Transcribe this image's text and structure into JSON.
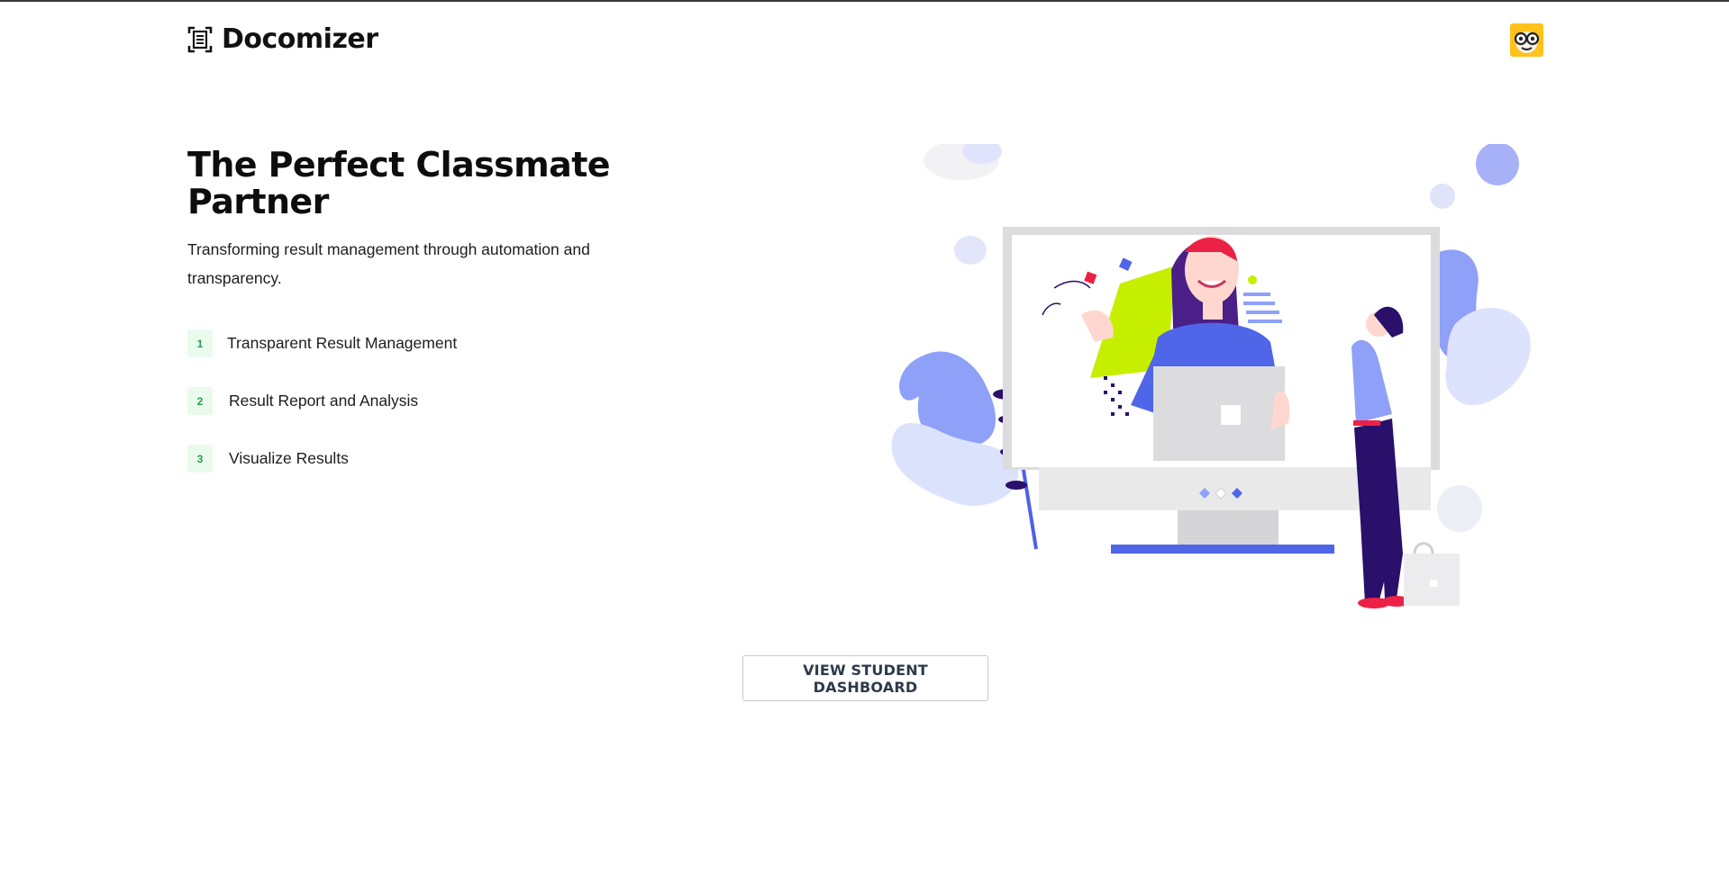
{
  "header": {
    "app_name": "Docomizer",
    "logo_icon": "document-scan-icon",
    "avatar_icon": "nerd-glasses-avatar",
    "avatar_color": "#ffc21a"
  },
  "hero": {
    "title": "The Perfect Classmate Partner",
    "subtitle": "Transforming result management through automation and transparency.",
    "illustration": "woman-in-monitor-illustration"
  },
  "features": [
    {
      "number": "1",
      "label": "Transparent Result Management"
    },
    {
      "number": "2",
      "label": "Result Report and Analysis"
    },
    {
      "number": "3",
      "label": "Visualize Results"
    }
  ],
  "cta": {
    "label": "VIEW STUDENT DASHBOARD"
  },
  "colors": {
    "accent_blue": "#5066e8",
    "badge_bg": "#eafbee",
    "badge_text": "#22a447",
    "lime": "#c6ef00",
    "red": "#ec2146",
    "purple_dark": "#2a0f6b"
  }
}
